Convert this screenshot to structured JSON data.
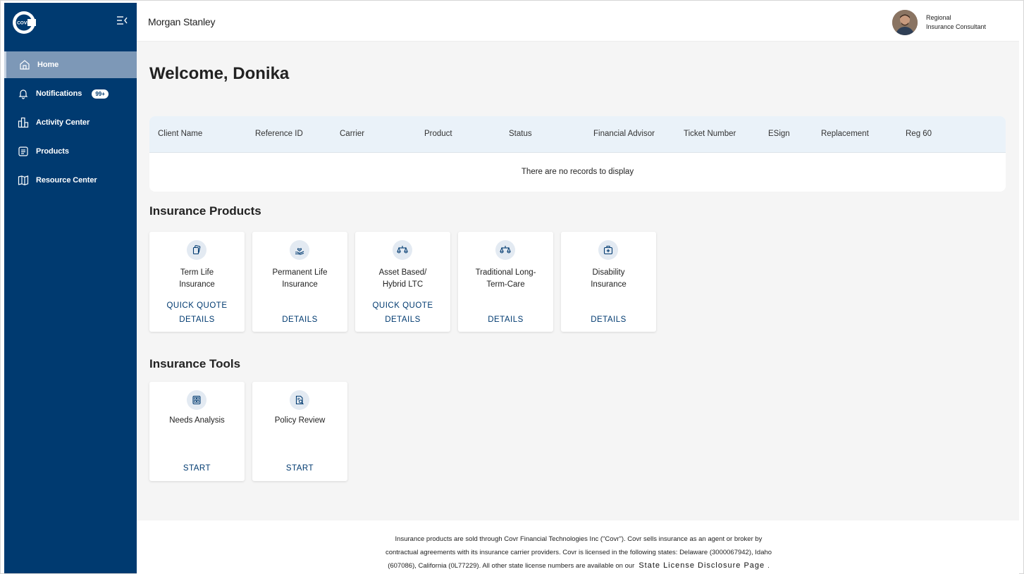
{
  "sidebar": {
    "logo_text": "COVR",
    "items": [
      {
        "label": "Home"
      },
      {
        "label": "Notifications",
        "badge": "99+"
      },
      {
        "label": "Activity Center"
      },
      {
        "label": "Products"
      },
      {
        "label": "Resource Center"
      }
    ]
  },
  "header": {
    "brand": "Morgan Stanley",
    "user_role_line1": "Regional",
    "user_role_line2": "Insurance Consultant"
  },
  "main": {
    "welcome": "Welcome, Donika",
    "table": {
      "columns": [
        "Client Name",
        "Reference ID",
        "Carrier",
        "Product",
        "Status",
        "Financial Advisor",
        "Ticket Number",
        "ESign",
        "Replacement",
        "Reg 60"
      ],
      "empty_message": "There are no records to display"
    },
    "products_title": "Insurance Products",
    "products": [
      {
        "title_line1": "Term Life",
        "title_line2": "Insurance",
        "quote": "QUICK QUOTE",
        "details": "DETAILS",
        "icon": "documents-icon"
      },
      {
        "title_line1": "Permanent Life",
        "title_line2": "Insurance",
        "details": "DETAILS",
        "icon": "hand-heart-icon"
      },
      {
        "title_line1": "Asset Based/",
        "title_line2": "Hybrid LTC",
        "quote": "QUICK QUOTE",
        "details": "DETAILS",
        "icon": "scale-icon"
      },
      {
        "title_line1": "Traditional Long-",
        "title_line2": "Term-Care",
        "details": "DETAILS",
        "icon": "scale-icon"
      },
      {
        "title_line1": "Disability",
        "title_line2": "Insurance",
        "details": "DETAILS",
        "icon": "medical-kit-icon"
      }
    ],
    "tools_title": "Insurance Tools",
    "tools": [
      {
        "title": "Needs Analysis",
        "action": "START",
        "icon": "calculator-icon"
      },
      {
        "title": "Policy Review",
        "action": "START",
        "icon": "document-search-icon"
      }
    ]
  },
  "footer": {
    "line1": "Insurance products are sold through Covr Financial Technologies Inc (\"Covr\"). Covr sells insurance as an agent or broker by",
    "line2": "contractual agreements with its insurance carrier providers. Covr is licensed in the following states: Delaware (3000067942), Idaho",
    "line3": "(607086), California (0L77229). All other state license numbers are available on our",
    "link": "State License Disclosure Page",
    "period": "."
  },
  "colors": {
    "sidebar": "#003a70",
    "active_nav": "#7d98b7",
    "accent": "#003a70",
    "table_header": "#eaf2f9",
    "background": "#f5f5f5"
  }
}
